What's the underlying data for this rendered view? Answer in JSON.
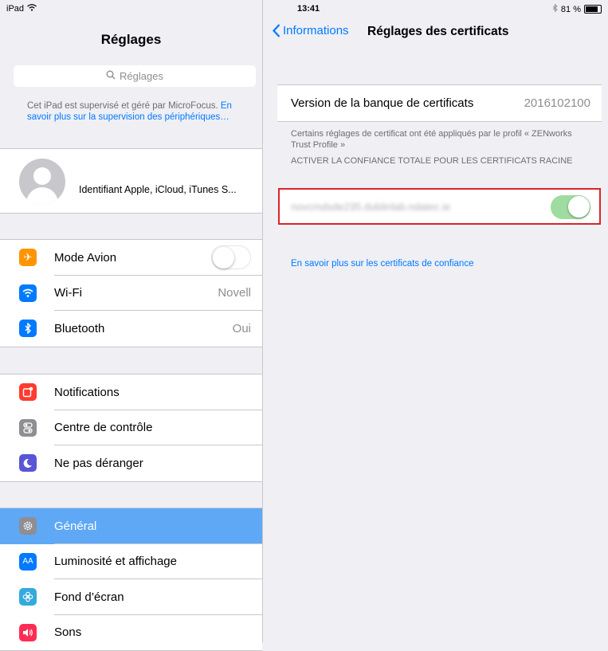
{
  "status_bar": {
    "device": "iPad",
    "time": "13:41",
    "battery": "81 %",
    "battery_level": 0.81
  },
  "master": {
    "title": "Réglages",
    "search_placeholder": "Réglages",
    "supervision_text": "Cet iPad est supervisé et géré par MicroFocus.",
    "supervision_link": "En savoir plus sur la supervision des périphériques…",
    "account_label": "Identifiant Apple, iCloud, iTunes S...",
    "groups": [
      [
        {
          "label": "Mode Avion",
          "icon": "airplane-icon",
          "color": "#ff9500",
          "toggle": "off"
        },
        {
          "label": "Wi-Fi",
          "icon": "wifi-icon",
          "color": "#007aff",
          "value": "Novell"
        },
        {
          "label": "Bluetooth",
          "icon": "bluetooth-icon",
          "color": "#007aff",
          "value": "Oui"
        }
      ],
      [
        {
          "label": "Notifications",
          "icon": "notifications-icon",
          "color": "#ff3b30"
        },
        {
          "label": "Centre de contrôle",
          "icon": "control-center-icon",
          "color": "#8e8e93"
        },
        {
          "label": "Ne pas déranger",
          "icon": "moon-icon",
          "color": "#5856d6"
        }
      ],
      [
        {
          "label": "Général",
          "icon": "gear-icon",
          "color": "#8e8e93",
          "selected": true
        },
        {
          "label": "Luminosité et affichage",
          "icon": "brightness-icon",
          "color": "#007aff"
        },
        {
          "label": "Fond d’écran",
          "icon": "wallpaper-icon",
          "color": "#34aadc"
        },
        {
          "label": "Sons",
          "icon": "speaker-icon",
          "color": "#ff2d55"
        }
      ]
    ]
  },
  "detail": {
    "back_label": "Informations",
    "title": "Réglages des certificats",
    "trust_store_label": "Version de la banque de certificats",
    "trust_store_value": "2016102100",
    "profile_note": "Certains réglages de certificat ont été appliqués par le profil « ZENworks Trust Profile »",
    "section_header": "ACTIVER LA CONFIANCE TOTALE POUR LES CERTIFICATS RACINE",
    "certificate_name": "novcmdsde235.dublinlab.ndatec.ie",
    "certificate_toggle": "on",
    "learn_more_link": "En savoir plus sur les certificats de confiance",
    "highlight_color": "#d9252a"
  }
}
